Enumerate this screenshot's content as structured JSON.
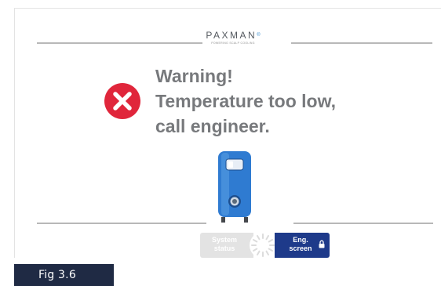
{
  "header": {
    "brand_name": "PAXMAN",
    "brand_mark": "®",
    "brand_tagline": "POWERING SCALP COOLING"
  },
  "alert": {
    "icon": "error-x-icon",
    "line1": "Warning!",
    "line2": "Temperature too low,",
    "line3": "call engineer.",
    "icon_color": "#e0263b"
  },
  "device": {
    "icon": "cooling-machine-icon",
    "color": "#2f7bd1"
  },
  "footer": {
    "system_status_line1": "System",
    "system_status_line2": "status",
    "eng_screen_line1": "Eng.",
    "eng_screen_line2": "screen",
    "eng_icon": "lock-icon",
    "eng_color": "#1e3a8a",
    "spinner_icon": "loading-spinner-icon"
  },
  "figure": {
    "label": "Fig 3.6"
  }
}
